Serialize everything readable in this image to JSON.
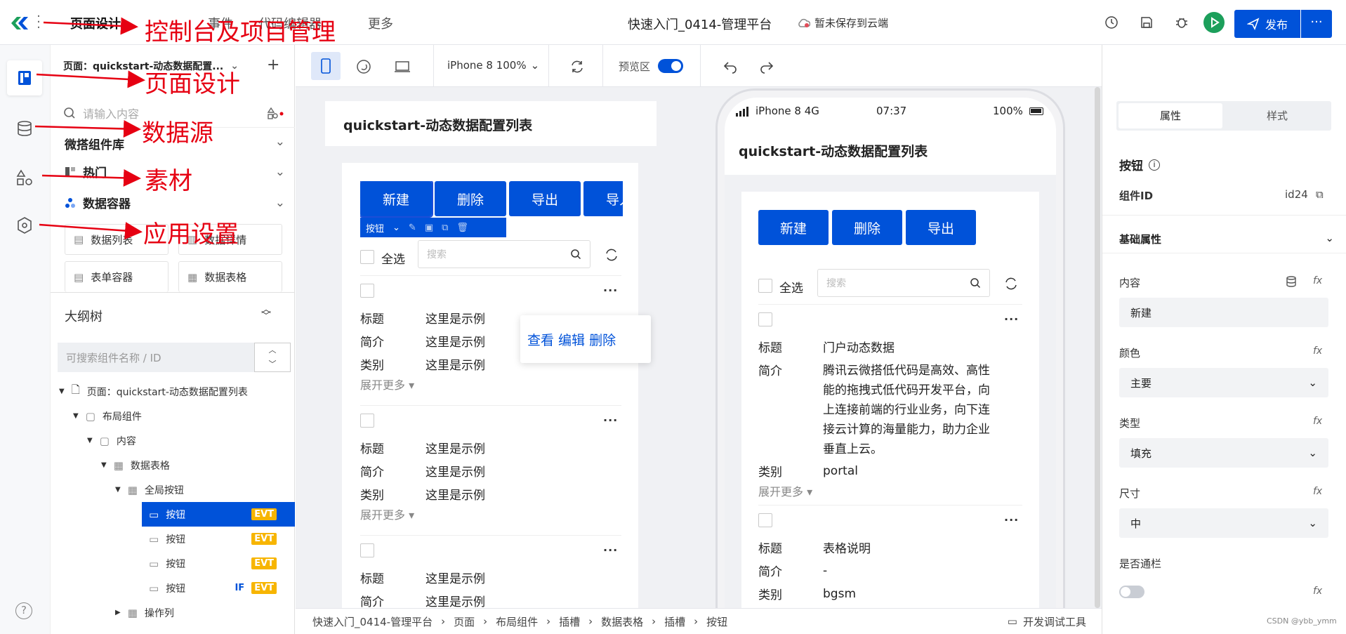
{
  "topbar": {
    "menu": [
      "页面设计",
      "事件",
      "代码编辑器",
      "更多"
    ],
    "project_title": "快速入门_0414-管理平台",
    "cloud_status": "暂未保存到云端",
    "publish_label": "发布",
    "more_label": "···"
  },
  "left_panel": {
    "page_selector": "页面：quickstart-动态数据配置...",
    "search_placeholder": "请输入内容",
    "categories": [
      "微搭组件库",
      "热门",
      "数据容器"
    ],
    "components": [
      "数据列表",
      "数据详情",
      "表单容器",
      "数据表格"
    ],
    "outline_title": "大纲树",
    "outline_search_placeholder": "可搜索组件名称 / ID",
    "tree": [
      {
        "label": "页面：quickstart-动态数据配置列表"
      },
      {
        "label": "布局组件"
      },
      {
        "label": "内容"
      },
      {
        "label": "数据表格"
      },
      {
        "label": "全局按钮"
      },
      {
        "label": "按钮",
        "badge": "EVT"
      },
      {
        "label": "按钮",
        "badge": "EVT"
      },
      {
        "label": "按钮",
        "badge": "EVT"
      },
      {
        "label": "按钮",
        "if": "IF",
        "badge": "EVT"
      },
      {
        "label": "操作列"
      }
    ]
  },
  "toolbar": {
    "device": "iPhone 8 100%",
    "preview_label": "预览区"
  },
  "editor_preview": {
    "page_title": "quickstart-动态数据配置列表",
    "buttons": [
      "新建",
      "删除",
      "导出",
      "导入"
    ],
    "selected_tag": "按钮",
    "select_all": "全选",
    "search_placeholder": "搜索",
    "popup_actions": "查看 编辑 删除",
    "items": [
      {
        "k1": "标题",
        "v1": "这里是示例",
        "k2": "简介",
        "v2": "这里是示例",
        "k3": "类别",
        "v3": "这里是示例"
      },
      {
        "k1": "标题",
        "v1": "这里是示例",
        "k2": "简介",
        "v2": "这里是示例",
        "k3": "类别",
        "v3": "这里是示例"
      },
      {
        "k1": "标题",
        "v1": "这里是示例",
        "k2": "简介",
        "v2": "这里是示例"
      }
    ],
    "expand_more": "展开更多 ▾",
    "dots": "···"
  },
  "phone_preview": {
    "status": {
      "carrier": "iPhone 8  4G",
      "time": "07:37",
      "battery": "100%"
    },
    "page_title": "quickstart-动态数据配置列表",
    "buttons": [
      "新建",
      "删除",
      "导出"
    ],
    "select_all": "全选",
    "search_placeholder": "搜索",
    "item1": {
      "title_key": "标题",
      "title": "门户动态数据",
      "intro_key": "简介",
      "intro": "腾讯云微搭低代码是高效、高性能的拖拽式低代码开发平台，向上连接前端的行业业务，向下连接云计算的海量能力，助力企业垂直上云。",
      "cat_key": "类别",
      "cat": "portal"
    },
    "item2": {
      "title_key": "标题",
      "title": "表格说明",
      "intro_key": "简介",
      "intro": "-",
      "cat_key": "类别",
      "cat": "bgsm"
    },
    "expand_more": "展开更多 ▾"
  },
  "right_panel": {
    "tabs": [
      "属性",
      "样式"
    ],
    "component_name": "按钮",
    "id_label": "组件ID",
    "id_value": "id24",
    "section": "基础属性",
    "content_label": "内容",
    "content_value": "新建",
    "color_label": "颜色",
    "color_value": "主要",
    "type_label": "类型",
    "type_value": "填充",
    "size_label": "尺寸",
    "size_value": "中",
    "block_label": "是否通栏",
    "fx": "fx"
  },
  "breadcrumb": [
    "快速入门_0414-管理平台",
    "页面",
    "布局组件",
    "插槽",
    "数据表格",
    "插槽",
    "按钮"
  ],
  "devtools_label": "开发调试工具",
  "watermark": "CSDN @ybb_ymm",
  "annotations": [
    "控制台及项目管理",
    "页面设计",
    "数据源",
    "素材",
    "应用设置"
  ],
  "colors": {
    "primary": "#0052d9",
    "evt": "#f7b500",
    "annotation": "#e60012"
  }
}
